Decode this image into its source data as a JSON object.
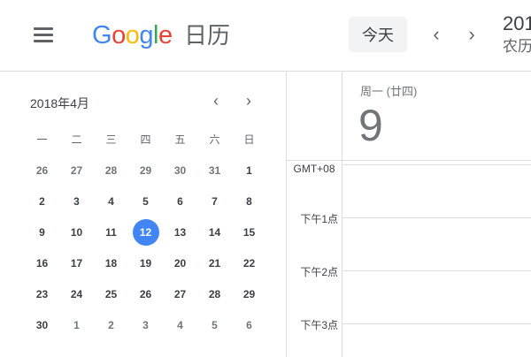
{
  "header": {
    "logo": [
      "G",
      "o",
      "o",
      "g",
      "l",
      "e"
    ],
    "logo_colors": [
      "#4285f4",
      "#ea4335",
      "#fbbc05",
      "#4285f4",
      "#34a853",
      "#ea4335"
    ],
    "app_name": "日历",
    "today_label": "今天",
    "prev_icon": "‹",
    "next_icon": "›",
    "date_partial": "201",
    "lunar_partial": "农历"
  },
  "mini_calendar": {
    "title": "2018年4月",
    "weekdays": [
      "一",
      "二",
      "三",
      "四",
      "五",
      "六",
      "日"
    ],
    "weeks": [
      [
        {
          "d": "26",
          "o": true
        },
        {
          "d": "27",
          "o": true
        },
        {
          "d": "28",
          "o": true
        },
        {
          "d": "29",
          "o": true
        },
        {
          "d": "30",
          "o": true
        },
        {
          "d": "31",
          "o": true
        },
        {
          "d": "1",
          "o": false
        }
      ],
      [
        {
          "d": "2",
          "o": false
        },
        {
          "d": "3",
          "o": false
        },
        {
          "d": "4",
          "o": false
        },
        {
          "d": "5",
          "o": false
        },
        {
          "d": "6",
          "o": false
        },
        {
          "d": "7",
          "o": false
        },
        {
          "d": "8",
          "o": false
        }
      ],
      [
        {
          "d": "9",
          "o": false
        },
        {
          "d": "10",
          "o": false
        },
        {
          "d": "11",
          "o": false
        },
        {
          "d": "12",
          "o": false,
          "sel": true
        },
        {
          "d": "13",
          "o": false
        },
        {
          "d": "14",
          "o": false
        },
        {
          "d": "15",
          "o": false
        }
      ],
      [
        {
          "d": "16",
          "o": false
        },
        {
          "d": "17",
          "o": false
        },
        {
          "d": "18",
          "o": false
        },
        {
          "d": "19",
          "o": false
        },
        {
          "d": "20",
          "o": false
        },
        {
          "d": "21",
          "o": false
        },
        {
          "d": "22",
          "o": false
        }
      ],
      [
        {
          "d": "23",
          "o": false
        },
        {
          "d": "24",
          "o": false
        },
        {
          "d": "25",
          "o": false
        },
        {
          "d": "26",
          "o": false
        },
        {
          "d": "27",
          "o": false
        },
        {
          "d": "28",
          "o": false
        },
        {
          "d": "29",
          "o": false
        }
      ],
      [
        {
          "d": "30",
          "o": false
        },
        {
          "d": "1",
          "o": true
        },
        {
          "d": "2",
          "o": true
        },
        {
          "d": "3",
          "o": true
        },
        {
          "d": "4",
          "o": true
        },
        {
          "d": "5",
          "o": true
        },
        {
          "d": "6",
          "o": true
        }
      ]
    ],
    "selected_color": "#4285f4"
  },
  "day_view": {
    "dow_label": "周一 (廿四)",
    "date_number": "9",
    "timezone": "GMT+08",
    "hours": [
      "下午1点",
      "下午2点",
      "下午3点"
    ]
  }
}
